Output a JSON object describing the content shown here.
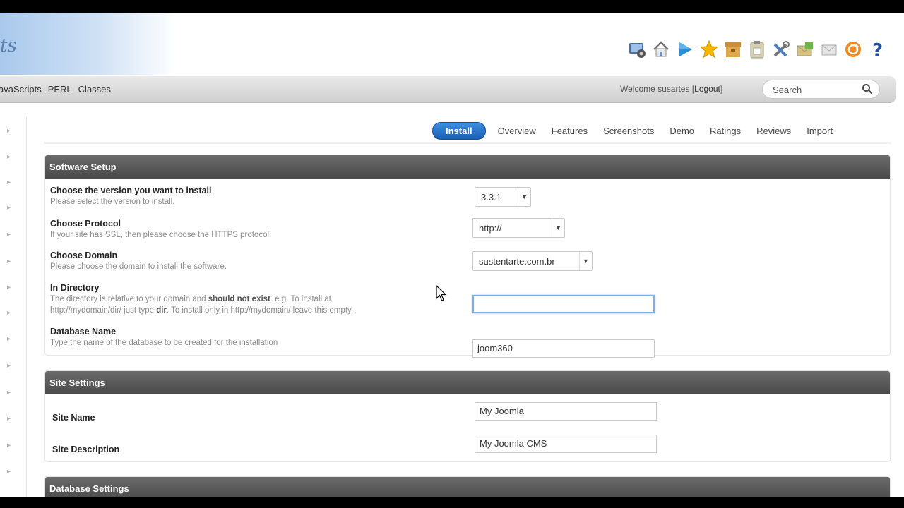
{
  "header": {
    "logo_text": "ts",
    "toolbar_icons": [
      "settings-monitor-icon",
      "home-icon",
      "play-icon",
      "star-icon",
      "archive-icon",
      "clipboard-icon",
      "tools-icon",
      "email-icon",
      "mail-icon",
      "refresh-icon",
      "help-icon"
    ]
  },
  "nav": {
    "links": [
      "avaScripts",
      "PERL",
      "Classes"
    ],
    "welcome_prefix": "Welcome susartes [",
    "logout": "Logout",
    "welcome_suffix": "]",
    "search_placeholder": "Search"
  },
  "tabs": [
    "Install",
    "Overview",
    "Features",
    "Screenshots",
    "Demo",
    "Ratings",
    "Reviews",
    "Import"
  ],
  "software_setup": {
    "title": "Software Setup",
    "version": {
      "label": "Choose the version you want to install",
      "help": "Please select the version to install.",
      "value": "3.3.1"
    },
    "protocol": {
      "label": "Choose Protocol",
      "help": "If your site has SSL, then please choose the HTTPS protocol.",
      "value": "http://"
    },
    "domain": {
      "label": "Choose Domain",
      "help": "Please choose the domain to install the software.",
      "value": "sustentarte.com.br"
    },
    "directory": {
      "label": "In Directory",
      "help_1": "The directory is relative to your domain and ",
      "help_bold_1": "should not exist",
      "help_2": ". e.g. To install at",
      "help_3": "http://mydomain/dir/ just type ",
      "help_bold_2": "dir",
      "help_4": ". To install only in http://mydomain/ leave this empty.",
      "value": ""
    },
    "database": {
      "label": "Database Name",
      "help": "Type the name of the database to be created for the installation",
      "value": "joom360"
    }
  },
  "site_settings": {
    "title": "Site Settings",
    "site_name": {
      "label": "Site Name",
      "value": "My Joomla"
    },
    "site_description": {
      "label": "Site Description",
      "value": "My Joomla CMS"
    }
  },
  "database_settings": {
    "title": "Database Settings"
  },
  "colors": {
    "tab_active": "#1b5fb5",
    "panel_head": "#555555",
    "focus_border": "#7ab0e8"
  }
}
